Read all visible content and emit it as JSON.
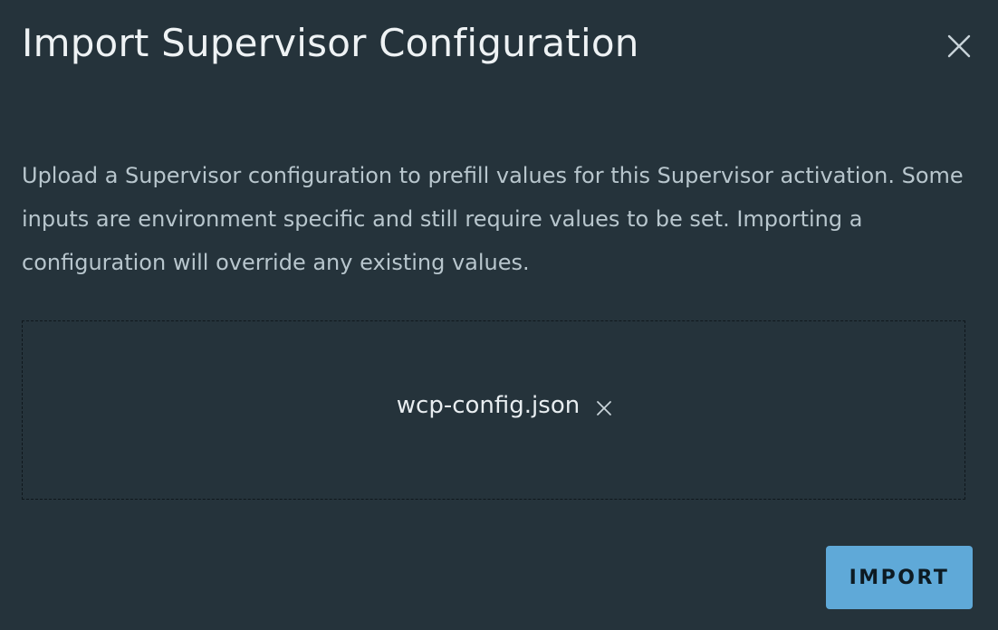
{
  "dialog": {
    "title": "Import Supervisor Configuration",
    "close_icon": "close-icon",
    "description": "Upload a Supervisor configuration to prefill values for this Supervisor activation. Some inputs are environment specific and still require values to be set. Importing a configuration will override any existing values.",
    "dropzone": {
      "file_name": "wcp-config.json",
      "remove_icon": "close-icon"
    },
    "import_label": "IMPORT"
  },
  "colors": {
    "background": "#25333b",
    "title": "#eef2f4",
    "description": "#b8c6cd",
    "primary_button": "#5fa9d8",
    "primary_button_text": "#0d1a22"
  }
}
